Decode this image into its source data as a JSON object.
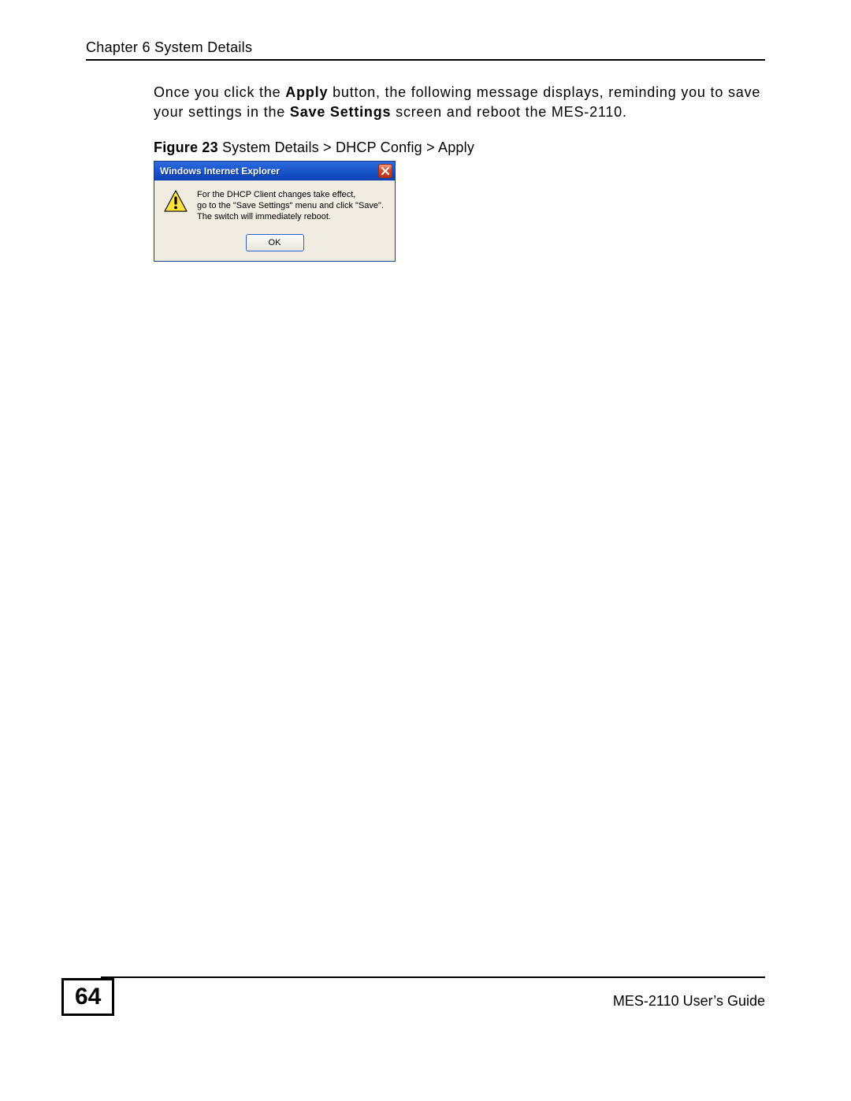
{
  "header": {
    "chapter": "Chapter 6 System Details"
  },
  "body": {
    "para_pre": "Once you click the ",
    "para_bold1": "Apply",
    "para_mid": " button, the following message displays, reminding you to save your settings in the ",
    "para_bold2": "Save Settings",
    "para_post": " screen and reboot the MES-2110."
  },
  "figure": {
    "label": "Figure 23",
    "caption": "   System Details > DHCP Config > Apply",
    "dialog": {
      "title": "Windows Internet Explorer",
      "close_name": "close-icon",
      "warn_name": "warning-icon",
      "message_line1": "For the DHCP Client changes take effect,",
      "message_line2": "go to the \"Save Settings\" menu and click \"Save\".",
      "message_line3": "The switch will immediately reboot.",
      "ok_label": "OK"
    }
  },
  "footer": {
    "page_number": "64",
    "guide": "MES-2110 User’s Guide"
  }
}
